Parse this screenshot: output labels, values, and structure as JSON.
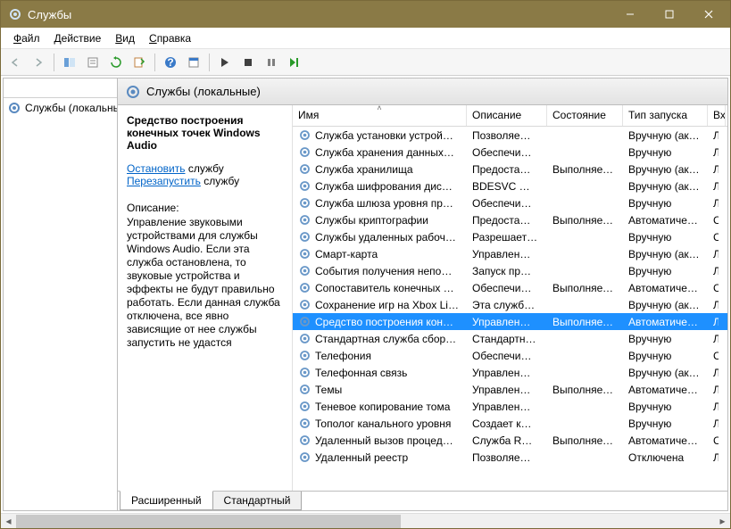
{
  "window": {
    "title": "Службы"
  },
  "menu": [
    "Файл",
    "Действие",
    "Вид",
    "Справка"
  ],
  "left": {
    "node": "Службы (локальные)"
  },
  "header": {
    "label": "Службы (локальные)"
  },
  "detail": {
    "title": "Средство построения конечных точек Windows Audio",
    "stop_pre": "Остановить",
    "stop_suf": " службу",
    "restart_pre": "Перезапустить",
    "restart_suf": " службу",
    "desc_label": "Описание:",
    "desc": "Управление звуковыми устройствами для службы Windows Audio.  Если эта служба остановлена, то звуковые устройства и эффекты не будут правильно работать.  Если данная служба отключена, все явно зависящие от нее службы запустить не удастся"
  },
  "columns": {
    "name": "Имя",
    "desc": "Описание",
    "state": "Состояние",
    "start": "Тип запуска",
    "logon": "Вход от имени"
  },
  "tabs": {
    "ext": "Расширенный",
    "std": "Стандартный"
  },
  "rows": [
    {
      "name": "Служба установки устрой…",
      "desc": "Позволяе…",
      "state": "",
      "start": "Вручную (ак…",
      "logon": "Л"
    },
    {
      "name": "Служба хранения данных…",
      "desc": "Обеспечи…",
      "state": "",
      "start": "Вручную",
      "logon": "Л"
    },
    {
      "name": "Служба хранилища",
      "desc": "Предоста…",
      "state": "Выполняется",
      "start": "Вручную (ак…",
      "logon": "Л"
    },
    {
      "name": "Служба шифрования дис…",
      "desc": "BDESVC …",
      "state": "",
      "start": "Вручную (ак…",
      "logon": "Л"
    },
    {
      "name": "Служба шлюза уровня пр…",
      "desc": "Обеспечи…",
      "state": "",
      "start": "Вручную",
      "logon": "Л"
    },
    {
      "name": "Службы криптографии",
      "desc": "Предоста…",
      "state": "Выполняется",
      "start": "Автоматиче…",
      "logon": "С"
    },
    {
      "name": "Службы удаленных рабоч…",
      "desc": "Разрешает…",
      "state": "",
      "start": "Вручную",
      "logon": "С"
    },
    {
      "name": "Смарт-карта",
      "desc": "Управлен…",
      "state": "",
      "start": "Вручную (ак…",
      "logon": "Л"
    },
    {
      "name": "События получения непо…",
      "desc": "Запуск пр…",
      "state": "",
      "start": "Вручную",
      "logon": "Л"
    },
    {
      "name": "Сопоставитель конечных …",
      "desc": "Обеспечи…",
      "state": "Выполняется",
      "start": "Автоматиче…",
      "logon": "С"
    },
    {
      "name": "Сохранение игр на Xbox Li…",
      "desc": "Эта служб…",
      "state": "",
      "start": "Вручную (ак…",
      "logon": "Л"
    },
    {
      "name": "Средство построения кон…",
      "desc": "Управлен…",
      "state": "Выполняется",
      "start": "Автоматиче…",
      "logon": "Л",
      "selected": true
    },
    {
      "name": "Стандартная служба сбор…",
      "desc": "Стандартн…",
      "state": "",
      "start": "Вручную",
      "logon": "Л"
    },
    {
      "name": "Телефония",
      "desc": "Обеспечи…",
      "state": "",
      "start": "Вручную",
      "logon": "С"
    },
    {
      "name": "Телефонная связь",
      "desc": "Управлен…",
      "state": "",
      "start": "Вручную (ак…",
      "logon": "Л"
    },
    {
      "name": "Темы",
      "desc": "Управлен…",
      "state": "Выполняется",
      "start": "Автоматиче…",
      "logon": "Л"
    },
    {
      "name": "Теневое копирование тома",
      "desc": "Управлен…",
      "state": "",
      "start": "Вручную",
      "logon": "Л"
    },
    {
      "name": "Тополог канального уровня",
      "desc": "Создает к…",
      "state": "",
      "start": "Вручную",
      "logon": "Л"
    },
    {
      "name": "Удаленный вызов процед…",
      "desc": "Служба R…",
      "state": "Выполняется",
      "start": "Автоматиче…",
      "logon": "С"
    },
    {
      "name": "Удаленный реестр",
      "desc": "Позволяе…",
      "state": "",
      "start": "Отключена",
      "logon": "Л"
    },
    {
      "name": "",
      "desc": "",
      "state": "",
      "start": "",
      "logon": ""
    }
  ]
}
